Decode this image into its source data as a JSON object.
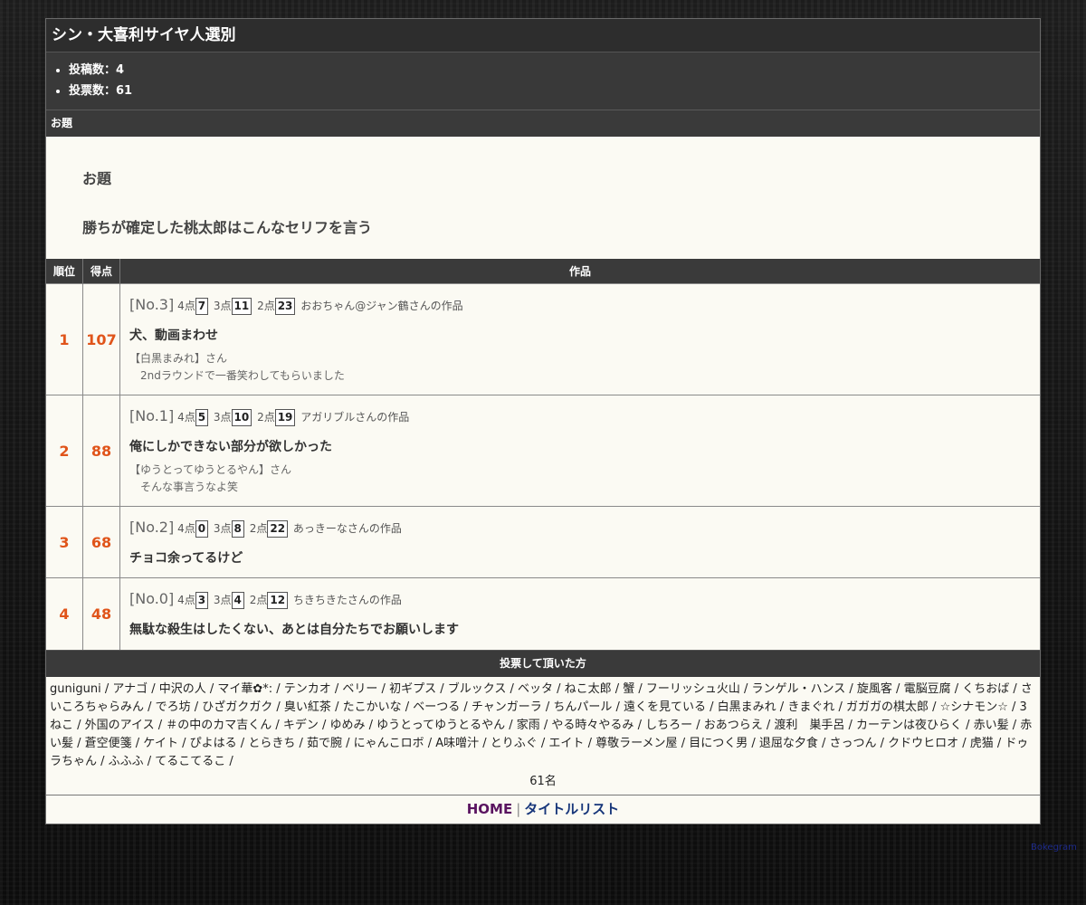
{
  "page": {
    "title": "シン・大喜利サイヤ人選別",
    "stats": [
      "投稿数：4",
      "投票数：61"
    ],
    "theme_section_label": "お題",
    "theme_label": "お題",
    "theme_text": "勝ちが確定した桃太郎はこんなセリフを言う"
  },
  "table": {
    "headers": [
      "順位",
      "得点",
      "作品"
    ],
    "rows": [
      {
        "rank": "1",
        "score": "107",
        "no": "[No.3]",
        "pts4_label": "4点",
        "pts4": "7",
        "pts3_label": "3点",
        "pts3": "11",
        "pts2_label": "2点",
        "pts2": "23",
        "author": "おおちゃん@ジャン鶴さんの作品",
        "text": "犬、動画まわせ",
        "comment_user": "【白黒まみれ】さん",
        "comment": "2ndラウンドで一番笑わしてもらいました"
      },
      {
        "rank": "2",
        "score": "88",
        "no": "[No.1]",
        "pts4_label": "4点",
        "pts4": "5",
        "pts3_label": "3点",
        "pts3": "10",
        "pts2_label": "2点",
        "pts2": "19",
        "author": "アガリブルさんの作品",
        "text": "俺にしかできない部分が欲しかった",
        "comment_user": "【ゆうとってゆうとるやん】さん",
        "comment": "そんな事言うなよ笑"
      },
      {
        "rank": "3",
        "score": "68",
        "no": "[No.2]",
        "pts4_label": "4点",
        "pts4": "0",
        "pts3_label": "3点",
        "pts3": "8",
        "pts2_label": "2点",
        "pts2": "22",
        "author": "あっきーなさんの作品",
        "text": "チョコ余ってるけど"
      },
      {
        "rank": "4",
        "score": "48",
        "no": "[No.0]",
        "pts4_label": "4点",
        "pts4": "3",
        "pts3_label": "3点",
        "pts3": "4",
        "pts2_label": "2点",
        "pts2": "12",
        "author": "ちきちきたさんの作品",
        "text": "無駄な殺生はしたくない、あとは自分たちでお願いします"
      }
    ]
  },
  "voters": {
    "label": "投票して頂いた方",
    "list": "guniguni / アナゴ / 中沢の人 / マイ華✿*: / テンカオ / ベリー / 初ギプス / ブルックス / ベッタ / ねこ太郎 / 蟹 / フーリッシュ火山 / ランゲル・ハンス / 旋風客 / 電脳豆腐 / くちおば / さいころちゃらみん / でろ坊 / ひざガクガク / 臭い紅茶 / たこかいな / ベーつる / チャンガーラ / ちんパール / 遠くを見ている / 白黒まみれ / きまぐれ / ガガガの棋太郎 / ☆シナモン☆ / 3ねこ / 外国のアイス / ＃の中のカマ吉くん / キデン / ゆめみ / ゆうとってゆうとるやん / 家雨 / やる時々やるみ / しちろー / おあつらえ / 渡利　巣手呂 / カーテンは夜ひらく / 赤い髪 / 赤い髪 / 蒼空便箋 / ケイト / ぴよはる / とらきち / 茹で腕 / にゃんこロボ / A味噌汁 / とりふぐ / エイト / 尊敬ラーメン屋 / 目につく男 / 退屈な夕食 / さっつん / クドウヒロオ / 虎猫 / ドゥラちゃん / ふふふ / てるこてるこ /",
    "count": "61名"
  },
  "footer": {
    "home": "HOME",
    "separator": "|",
    "title_list": "タイトルリスト"
  },
  "credit": "Bokegram"
}
